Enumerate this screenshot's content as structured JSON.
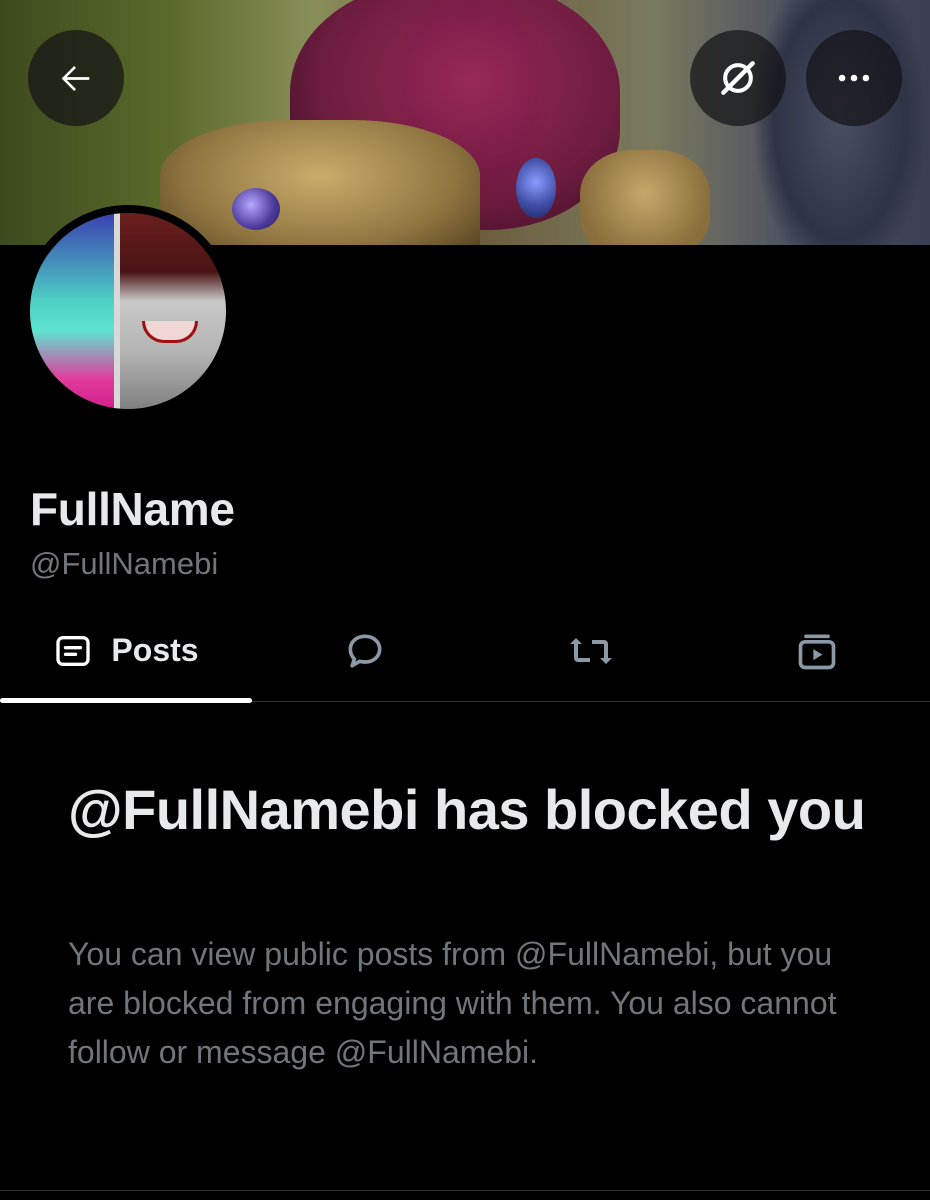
{
  "header": {
    "back_icon": "arrow-left-icon",
    "grok_icon": "grok-icon",
    "more_icon": "more-dots-icon"
  },
  "profile": {
    "display_name": "FullName",
    "handle": "@FullNamebi"
  },
  "tabs": [
    {
      "label": "Posts",
      "icon": "posts-icon",
      "selected": true
    },
    {
      "label": "",
      "icon": "replies-bubble-icon",
      "selected": false
    },
    {
      "label": "",
      "icon": "repost-icon",
      "selected": false
    },
    {
      "label": "",
      "icon": "media-play-icon",
      "selected": false
    }
  ],
  "blocked": {
    "title": "@FullNamebi has blocked you",
    "body": "You can view public posts from @FullNamebi, but you are blocked from engaging with them. You also cannot follow or message @FullNamebi."
  },
  "colors": {
    "background": "#000000",
    "primary_text": "#e7e9ea",
    "secondary_text": "#71767b",
    "divider": "#2f3336"
  }
}
